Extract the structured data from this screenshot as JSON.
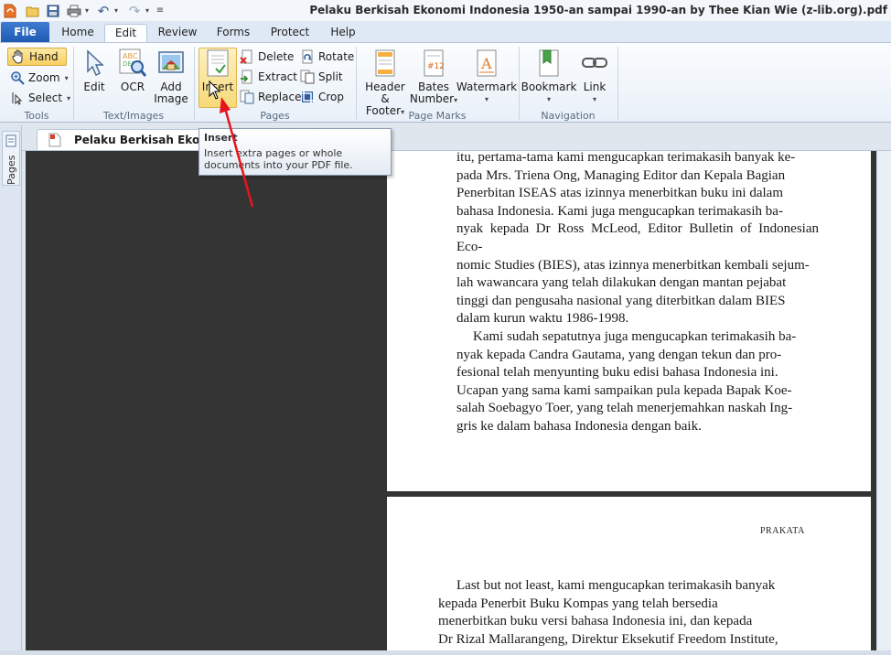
{
  "app": {
    "title": "Pelaku Berkisah Ekonomi Indonesia 1950-an sampai 1990-an by Thee Kian Wie (z-lib.org).pdf"
  },
  "tabs": {
    "file": "File",
    "home": "Home",
    "edit": "Edit",
    "review": "Review",
    "forms": "Forms",
    "protect": "Protect",
    "help": "Help"
  },
  "ribbon": {
    "tools": {
      "label": "Tools",
      "hand": "Hand",
      "zoom": "Zoom",
      "select": "Select"
    },
    "text_images": {
      "label": "Text/Images",
      "edit": "Edit",
      "ocr": "OCR",
      "add_image_line1": "Add",
      "add_image_line2": "Image"
    },
    "pages": {
      "label": "Pages",
      "insert": "Insert",
      "delete": "Delete",
      "extract": "Extract",
      "replace": "Replace",
      "rotate": "Rotate",
      "split": "Split",
      "crop": "Crop"
    },
    "page_marks": {
      "label": "Page Marks",
      "header_footer_line1": "Header &",
      "header_footer_line2": "Footer",
      "bates_line1": "Bates",
      "bates_line2": "Number",
      "watermark": "Watermark"
    },
    "navigation": {
      "label": "Navigation",
      "bookmark": "Bookmark",
      "link": "Link"
    }
  },
  "side": {
    "pages_tab": "Pages"
  },
  "document_tab": {
    "label": "Pelaku Berkisah Ekonomi I"
  },
  "tooltip": {
    "title": "Insert",
    "body": "Insert extra pages or whole documents into your PDF file."
  },
  "page1": {
    "lines": [
      "itu, pertama-tama kami mengucapkan terimakasih banyak ke-",
      "pada Mrs. Triena Ong, Managing Editor dan Kepala Bagian",
      "Penerbitan ISEAS atas izinnya menerbitkan buku ini dalam",
      "bahasa Indonesia. Kami juga mengucapkan terimakasih ba-",
      "nyak kepada Dr Ross McLeod, Editor Bulletin of Indonesian Eco-",
      "nomic Studies (BIES), atas izinnya menerbitkan kembali sejum-",
      "lah wawancara yang telah dilakukan dengan mantan pejabat",
      "tinggi dan pengusaha nasional yang diterbitkan dalam BIES",
      "dalam kurun waktu 1986-1998.",
      "Kami sudah sepatutnya juga mengucapkan terimakasih ba-",
      "nyak kepada Candra Gautama, yang dengan tekun dan pro-",
      "fesional telah menyunting buku edisi bahasa Indonesia ini.",
      "Ucapan yang sama kami sampaikan pula kepada Bapak Koe-",
      "salah Soebagyo Toer, yang telah menerjemahkan naskah Ing-",
      "gris ke dalam bahasa Indonesia dengan baik."
    ]
  },
  "page2": {
    "header": "PRAKATA",
    "lines": [
      "Last but not least, kami mengucapkan terimakasih banyak",
      "kepada Penerbit Buku Kompas yang telah bersedia",
      "menerbitkan buku versi bahasa Indonesia ini, dan kepada",
      "Dr Rizal Mallarangeng, Direktur Eksekutif Freedom Institute,"
    ]
  }
}
